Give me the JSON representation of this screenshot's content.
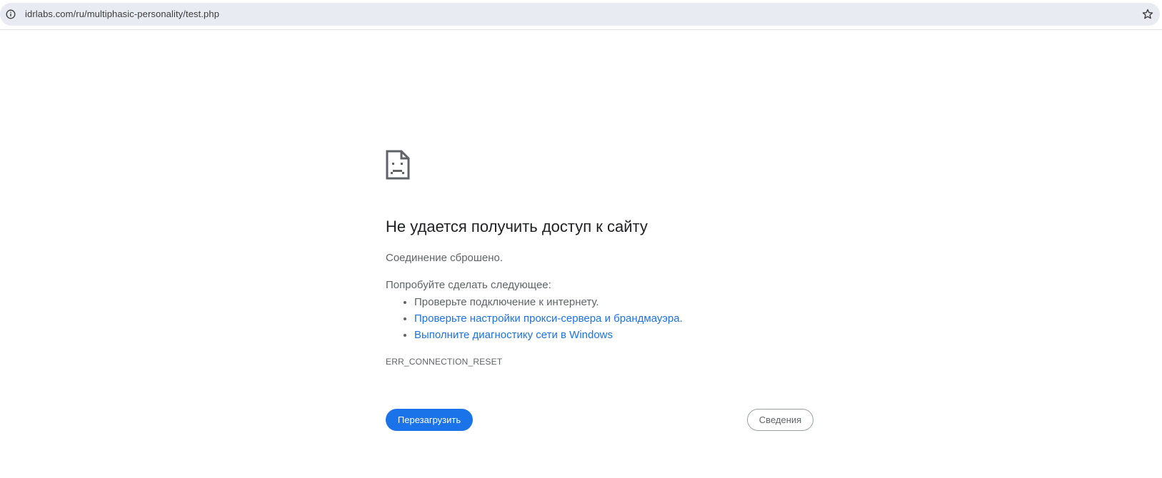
{
  "browser": {
    "url": "idrlabs.com/ru/multiphasic-personality/test.php",
    "site_info_icon": "info-circle-icon",
    "bookmark_icon": "star-outline-icon"
  },
  "error_page": {
    "icon": "sad-page-icon",
    "title": "Не удается получить доступ к сайту",
    "subtitle": "Соединение сброшено.",
    "try_heading": "Попробуйте сделать следующее:",
    "suggestions": [
      "Проверьте подключение к интернету.",
      "Проверьте настройки прокси-сервера и брандмауэра.",
      "Выполните диагностику сети в Windows"
    ],
    "error_code": "ERR_CONNECTION_RESET",
    "reload_label": "Перезагрузить",
    "details_label": "Сведения"
  },
  "colors": {
    "accent": "#1a73e8",
    "text_primary": "#202124",
    "text_secondary": "#5f6368",
    "omnibox_bg": "#e8ebf1"
  }
}
